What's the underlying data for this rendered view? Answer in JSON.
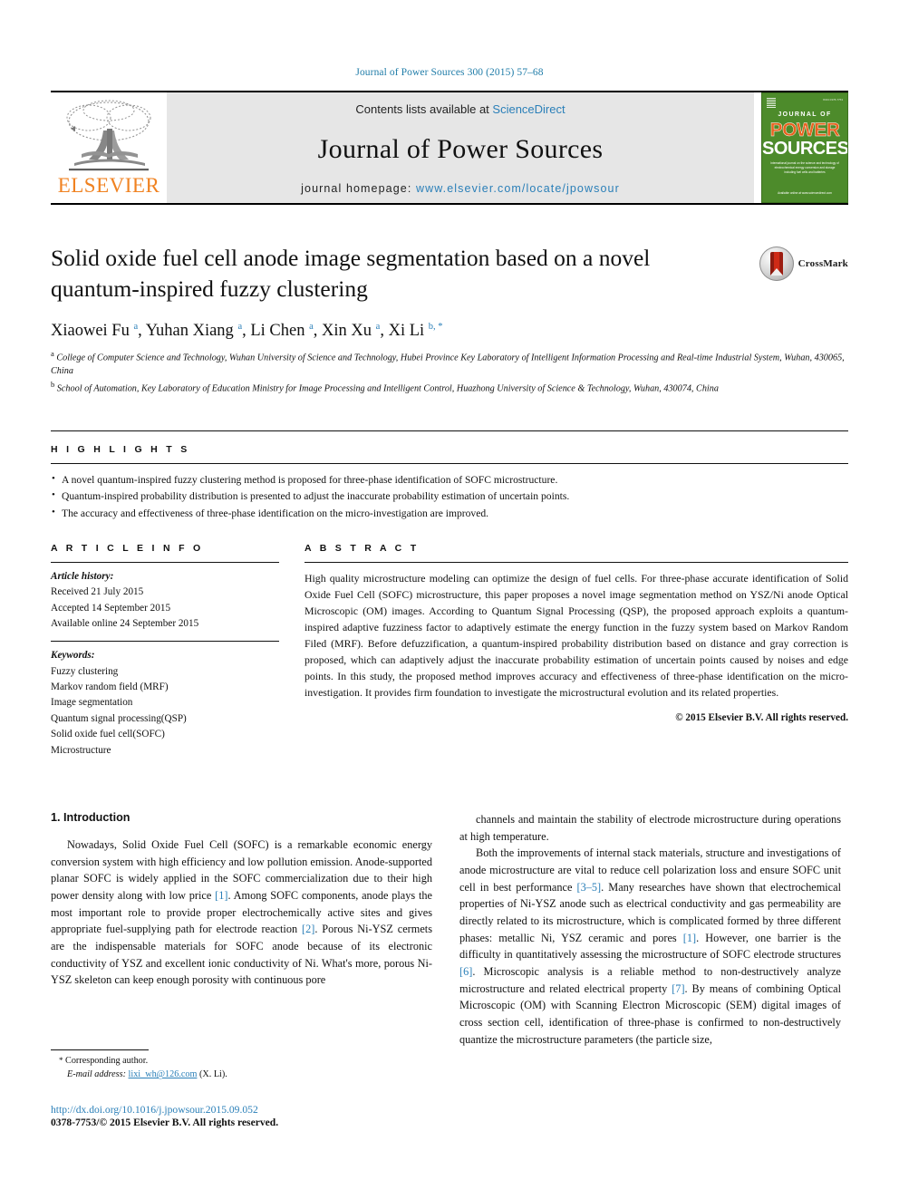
{
  "running_head": "Journal of Power Sources 300 (2015) 57–68",
  "banner": {
    "publisher_logo_label": "ELSEVIER",
    "contents_prefix": "Contents lists available at ",
    "contents_link": "ScienceDirect",
    "journal_title": "Journal of Power Sources",
    "homepage_prefix": "journal homepage: ",
    "homepage_url": "www.elsevier.com/locate/jpowsour",
    "cover": {
      "kicker": "JOURNAL OF",
      "word1": "POWER",
      "word2": "SOURCES",
      "issn": "ISSN 0378-7753",
      "subtitle": "International journal on the science and technology of electrochemical energy conversion and storage including fuel cells and batteries",
      "footer": "Available online at\nwww.sciencedirect.com"
    }
  },
  "article": {
    "title": "Solid oxide fuel cell anode image segmentation based on a novel quantum-inspired fuzzy clustering",
    "crossmark_label": "CrossMark",
    "authors_html": "Xiaowei Fu <sup>a</sup>, Yuhan Xiang <sup>a</sup>, Li Chen <sup>a</sup>, Xin Xu <sup>a</sup>, Xi Li <sup>b, *</sup>",
    "affiliations": [
      "a College of Computer Science and Technology, Wuhan University of Science and Technology, Hubei Province Key Laboratory of Intelligent Information Processing and Real-time Industrial System, Wuhan, 430065, China",
      "b School of Automation, Key Laboratory of Education Ministry for Image Processing and Intelligent Control, Huazhong University of Science & Technology, Wuhan, 430074, China"
    ]
  },
  "highlights": {
    "heading": "H I G H L I G H T S",
    "items": [
      "A novel quantum-inspired fuzzy clustering method is proposed for three-phase identification of SOFC microstructure.",
      "Quantum-inspired probability distribution is presented to adjust the inaccurate probability estimation of uncertain points.",
      "The accuracy and effectiveness of three-phase identification on the micro-investigation are improved."
    ]
  },
  "article_info": {
    "heading": "A R T I C L E   I N F O",
    "history_label": "Article history:",
    "history": [
      "Received 21 July 2015",
      "Accepted 14 September 2015",
      "Available online 24 September 2015"
    ],
    "keywords_label": "Keywords:",
    "keywords": [
      "Fuzzy clustering",
      "Markov random field (MRF)",
      "Image segmentation",
      "Quantum signal processing(QSP)",
      "Solid oxide fuel cell(SOFC)",
      "Microstructure"
    ]
  },
  "abstract": {
    "heading": "A B S T R A C T",
    "text": "High quality microstructure modeling can optimize the design of fuel cells. For three-phase accurate identification of Solid Oxide Fuel Cell (SOFC) microstructure, this paper proposes a novel image segmentation method on YSZ/Ni anode Optical Microscopic (OM) images. According to Quantum Signal Processing (QSP), the proposed approach exploits a quantum-inspired adaptive fuzziness factor to adaptively estimate the energy function in the fuzzy system based on Markov Random Filed (MRF). Before defuzzification, a quantum-inspired probability distribution based on distance and gray correction is proposed, which can adaptively adjust the inaccurate probability estimation of uncertain points caused by noises and edge points. In this study, the proposed method improves accuracy and effectiveness of three-phase identification on the micro-investigation. It provides firm foundation to investigate the microstructural evolution and its related properties.",
    "copyright": "© 2015 Elsevier B.V. All rights reserved."
  },
  "body": {
    "section_heading": "1.  Introduction",
    "left_paragraphs": [
      "Nowadays, Solid Oxide Fuel Cell (SOFC) is a remarkable economic energy conversion system with high efficiency and low pollution emission. Anode-supported planar SOFC is widely applied in the SOFC commercialization due to their high power density along with low price [1]. Among SOFC components, anode plays the most important role to provide proper electrochemically active sites and gives appropriate fuel-supplying path for electrode reaction [2]. Porous Ni-YSZ cermets are the indispensable materials for SOFC anode because of its electronic conductivity of YSZ and excellent ionic conductivity of Ni. What's more, porous Ni-YSZ skeleton can keep enough porosity with continuous pore"
    ],
    "right_paragraphs": [
      "channels and maintain the stability of electrode microstructure during operations at high temperature.",
      "Both the improvements of internal stack materials, structure and investigations of anode microstructure are vital to reduce cell polarization loss and ensure SOFC unit cell in best performance [3–5]. Many researches have shown that electrochemical properties of Ni-YSZ anode such as electrical conductivity and gas permeability are directly related to its microstructure, which is complicated formed by three different phases: metallic Ni, YSZ ceramic and pores [1]. However, one barrier is the difficulty in quantitatively assessing the microstructure of SOFC electrode structures [6]. Microscopic analysis is a reliable method to non-destructively analyze microstructure and related electrical property [7]. By means of combining Optical Microscopic (OM) with Scanning Electron Microscopic (SEM) digital images of cross section cell, identification of three-phase is confirmed to non-destructively quantize the microstructure parameters (the particle size,"
    ]
  },
  "footnote": {
    "star": "*",
    "corresponding": "Corresponding author.",
    "email_label": "E-mail address:",
    "email": "lixi_wh@126.com",
    "email_suffix": "(X. Li)."
  },
  "footer": {
    "doi_url": "http://dx.doi.org/10.1016/j.jpowsour.2015.09.052",
    "issn_line": "0378-7753/© 2015 Elsevier B.V. All rights reserved."
  },
  "colors": {
    "link_blue": "#2a7fb8",
    "elsevier_orange": "#f08221",
    "cover_green": "#4d8b2b",
    "power_orange": "#e8621f"
  }
}
